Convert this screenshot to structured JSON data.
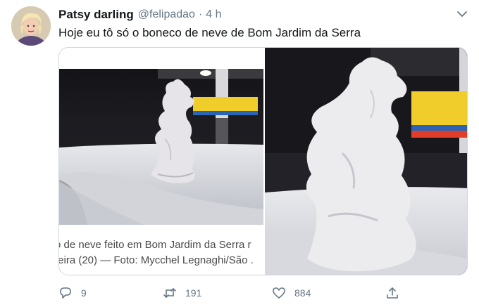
{
  "tweet": {
    "author_name": "Patsy darling",
    "handle": "@felipadao",
    "separator": "·",
    "time": "4 h",
    "text": "Hoje eu tô só o boneco de neve de Bom Jardim da Serra"
  },
  "media": {
    "caption_line_1": "o de neve feito em Bom Jardim da Serra r",
    "caption_line_2": "feira (20) — Foto: Mycchel Legnaghi/São ."
  },
  "actions": {
    "reply": {
      "icon": "reply-icon",
      "count": "9"
    },
    "retweet": {
      "icon": "retweet-icon",
      "count": "191"
    },
    "like": {
      "icon": "heart-icon",
      "count": "884"
    },
    "share": {
      "icon": "share-icon"
    }
  },
  "colors": {
    "text_primary": "#14171a",
    "text_secondary": "#657786",
    "border": "#ccd6dd"
  }
}
